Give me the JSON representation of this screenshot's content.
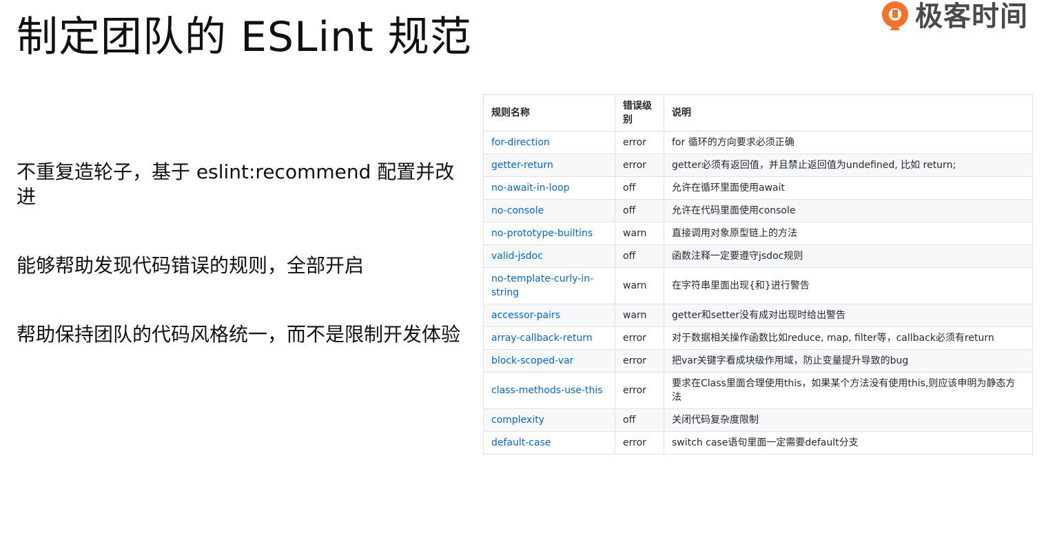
{
  "slide": {
    "title": "制定团队的 ESLint 规范"
  },
  "brand": {
    "name": "极客时间",
    "icon": "geektime-logo-icon",
    "icon_color": "#f0742b"
  },
  "bullets": [
    "不重复造轮子，基于 eslint:recommend 配置并改进",
    "能够帮助发现代码错误的规则，全部开启",
    "帮助保持团队的代码风格统一，而不是限制开发体验"
  ],
  "table": {
    "headers": [
      "规则名称",
      "错误级别",
      "说明"
    ],
    "rows": [
      {
        "name": "for-direction",
        "level": "error",
        "desc": "for 循环的方向要求必须正确"
      },
      {
        "name": "getter-return",
        "level": "error",
        "desc": "getter必须有返回值，并且禁止返回值为undefined, 比如 return;"
      },
      {
        "name": "no-await-in-loop",
        "level": "off",
        "desc": "允许在循环里面使用await"
      },
      {
        "name": "no-console",
        "level": "off",
        "desc": "允许在代码里面使用console"
      },
      {
        "name": "no-prototype-builtins",
        "level": "warn",
        "desc": "直接调用对象原型链上的方法"
      },
      {
        "name": "valid-jsdoc",
        "level": "off",
        "desc": "函数注释一定要遵守jsdoc规则"
      },
      {
        "name": "no-template-curly-in-string",
        "level": "warn",
        "desc": "在字符串里面出现{和}进行警告"
      },
      {
        "name": "accessor-pairs",
        "level": "warn",
        "desc": "getter和setter没有成对出现时给出警告"
      },
      {
        "name": "array-callback-return",
        "level": "error",
        "desc": "对于数据相关操作函数比如reduce, map, filter等，callback必须有return"
      },
      {
        "name": "block-scoped-var",
        "level": "error",
        "desc": "把var关键字看成块级作用域，防止变量提升导致的bug"
      },
      {
        "name": "class-methods-use-this",
        "level": "error",
        "desc": "要求在Class里面合理使用this，如果某个方法没有使用this,则应该申明为静态方法"
      },
      {
        "name": "complexity",
        "level": "off",
        "desc": "关闭代码复杂度限制"
      },
      {
        "name": "default-case",
        "level": "error",
        "desc": "switch case语句里面一定需要default分支"
      }
    ],
    "link_color": "#0366d6",
    "stripe_color": "#f6f8fa",
    "border_color": "#dfe2e5"
  }
}
